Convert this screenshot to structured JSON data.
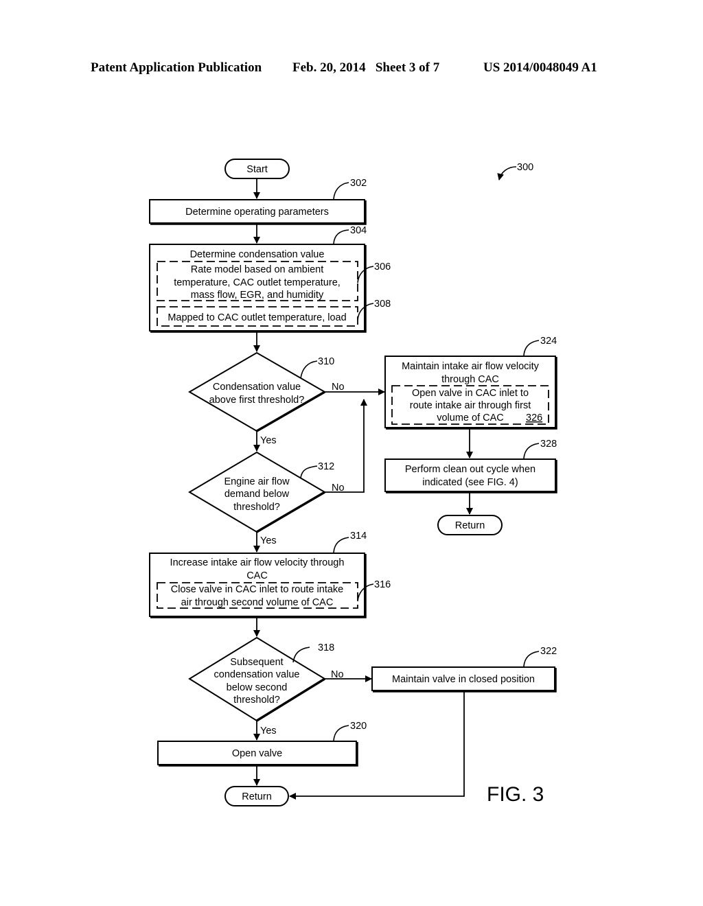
{
  "header": {
    "publication": "Patent Application Publication",
    "date_sheet": "Feb. 20, 2014   Sheet 3 of 7",
    "number": "US 2014/0048049 A1"
  },
  "figure": {
    "label": "FIG. 3",
    "ref": "300"
  },
  "nodes": {
    "start": {
      "text": "Start"
    },
    "n302": {
      "ref": "302",
      "text": "Determine operating parameters"
    },
    "n304": {
      "ref": "304",
      "title": "Determine condensation value"
    },
    "n306": {
      "ref": "306",
      "lines": [
        "Rate model based on ambient",
        "temperature, CAC outlet temperature,",
        "mass flow, EGR, and humidity"
      ]
    },
    "n308": {
      "ref": "308",
      "text": "Mapped to CAC outlet temperature, load"
    },
    "n310": {
      "ref": "310",
      "lines": [
        "Condensation value",
        "above first threshold?"
      ]
    },
    "n312": {
      "ref": "312",
      "lines": [
        "Engine air flow",
        "demand below",
        "threshold?"
      ]
    },
    "n314": {
      "ref": "314",
      "lines": [
        "Increase intake air flow velocity through",
        "CAC"
      ]
    },
    "n316": {
      "ref": "316",
      "lines": [
        "Close valve in CAC inlet to route intake",
        "air through second volume of CAC"
      ]
    },
    "n318": {
      "ref": "318",
      "lines": [
        "Subsequent",
        "condensation value",
        "below second",
        "threshold?"
      ]
    },
    "n320": {
      "ref": "320",
      "text": "Open valve"
    },
    "n322": {
      "ref": "322",
      "text": "Maintain valve in closed position"
    },
    "n324": {
      "ref": "324",
      "lines": [
        "Maintain intake air flow velocity",
        "through CAC"
      ]
    },
    "n326": {
      "ref": "326",
      "lines": [
        "Open valve in CAC inlet to",
        "route intake air through first",
        "volume of CAC"
      ]
    },
    "n328": {
      "ref": "328",
      "lines": [
        "Perform clean out cycle when",
        "indicated (see FIG. 4)"
      ]
    },
    "return_left": {
      "text": "Return"
    },
    "return_right": {
      "text": "Return"
    }
  },
  "edge_labels": {
    "yes": "Yes",
    "no": "No"
  }
}
